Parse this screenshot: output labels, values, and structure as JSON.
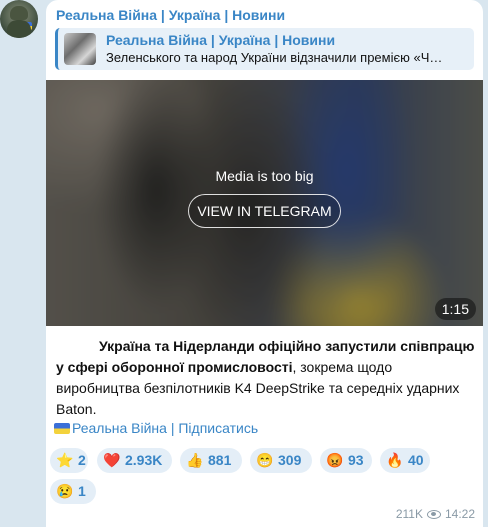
{
  "channel": {
    "name": "Реальна Війна | Україна | Новини"
  },
  "reply": {
    "title": "Реальна Війна | Україна | Новини",
    "text": "Зеленського та народ України відзначили премією «Ч…"
  },
  "media": {
    "notice": "Media is too big",
    "button_label": "VIEW IN TELEGRAM",
    "duration": "1:15"
  },
  "post": {
    "text_bold": "Україна та Нідерланди офіційно запустили співпрацю у сфері оборонної промисловості",
    "text_rest": ", зокрема щодо виробництва безпілотників K4 DeepStrike та середніх ударних Baton."
  },
  "subscribe": {
    "label": "Реальна Війна | Підписатись"
  },
  "reactions": [
    {
      "icon": "⭐",
      "count": "2"
    },
    {
      "icon": "❤️",
      "count": "2.93K"
    },
    {
      "icon": "👍",
      "count": "881"
    },
    {
      "icon": "😁",
      "count": "309"
    },
    {
      "icon": "😡",
      "count": "93"
    },
    {
      "icon": "🔥",
      "count": "40"
    },
    {
      "icon": "😢",
      "count": "1"
    }
  ],
  "meta": {
    "views": "211K",
    "time": "14:22"
  }
}
